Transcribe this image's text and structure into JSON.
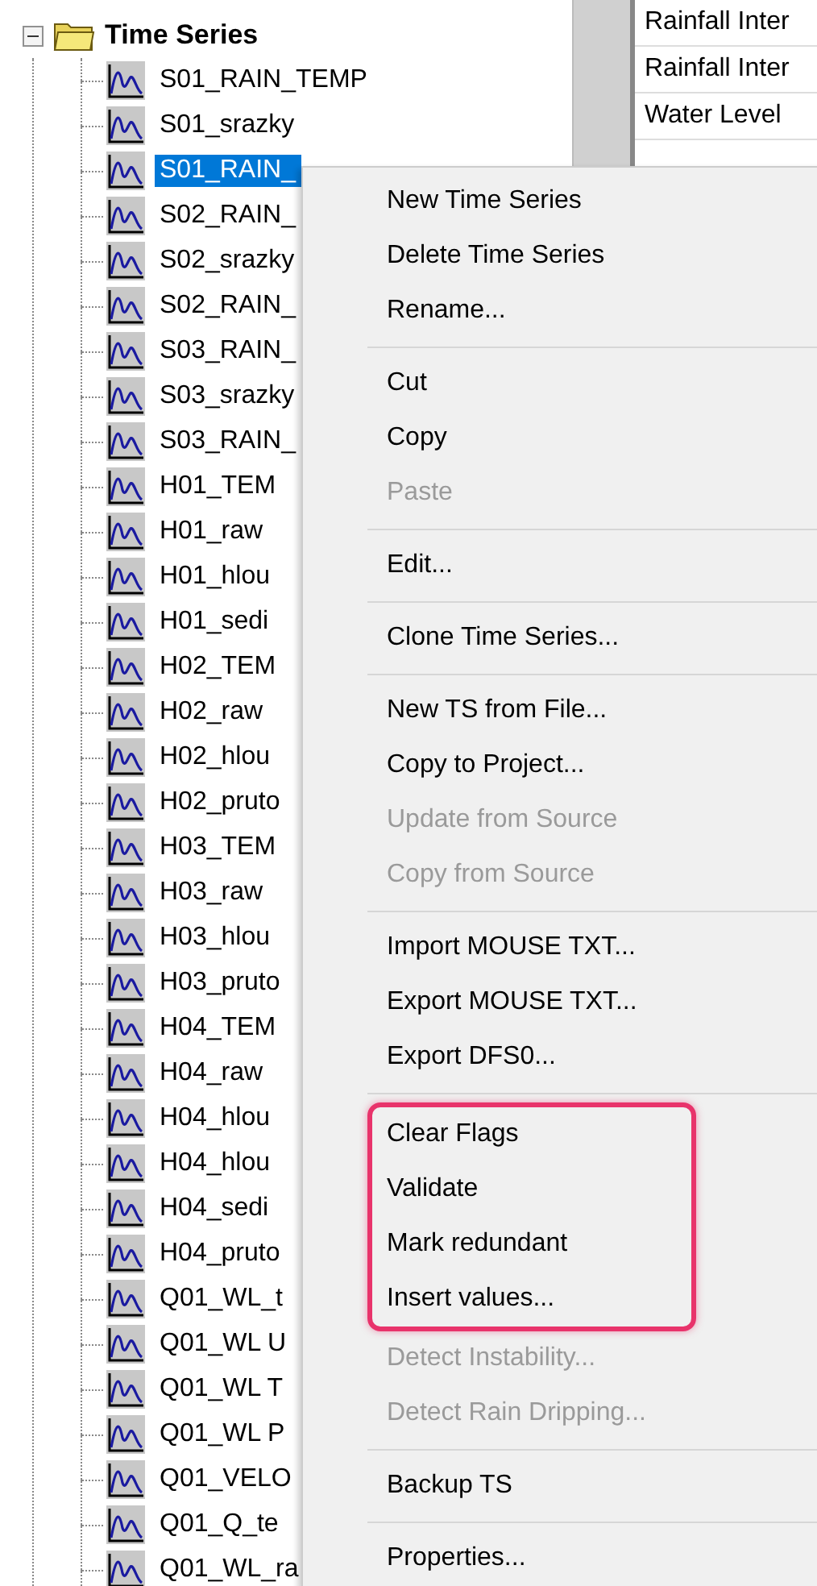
{
  "tree": {
    "root": {
      "label": "Time Series",
      "expanded": true
    },
    "items": [
      {
        "label": "S01_RAIN_TEMP",
        "selected": false
      },
      {
        "label": "S01_srazky",
        "selected": false
      },
      {
        "label": "S01_RAIN_",
        "selected": true
      },
      {
        "label": "S02_RAIN_",
        "selected": false
      },
      {
        "label": "S02_srazky",
        "selected": false
      },
      {
        "label": "S02_RAIN_",
        "selected": false
      },
      {
        "label": "S03_RAIN_",
        "selected": false
      },
      {
        "label": "S03_srazky",
        "selected": false
      },
      {
        "label": "S03_RAIN_",
        "selected": false
      },
      {
        "label": "H01_TEM",
        "selected": false
      },
      {
        "label": "H01_raw",
        "selected": false
      },
      {
        "label": "H01_hlou",
        "selected": false
      },
      {
        "label": "H01_sedi",
        "selected": false
      },
      {
        "label": "H02_TEM",
        "selected": false
      },
      {
        "label": "H02_raw",
        "selected": false
      },
      {
        "label": "H02_hlou",
        "selected": false
      },
      {
        "label": "H02_pruto",
        "selected": false
      },
      {
        "label": "H03_TEM",
        "selected": false
      },
      {
        "label": "H03_raw",
        "selected": false
      },
      {
        "label": "H03_hlou",
        "selected": false
      },
      {
        "label": "H03_pruto",
        "selected": false
      },
      {
        "label": "H04_TEM",
        "selected": false
      },
      {
        "label": "H04_raw",
        "selected": false
      },
      {
        "label": "H04_hlou",
        "selected": false
      },
      {
        "label": "H04_hlou",
        "selected": false
      },
      {
        "label": "H04_sedi",
        "selected": false
      },
      {
        "label": "H04_pruto",
        "selected": false
      },
      {
        "label": "Q01_WL_t",
        "selected": false
      },
      {
        "label": "Q01_WL U",
        "selected": false
      },
      {
        "label": "Q01_WL T",
        "selected": false
      },
      {
        "label": "Q01_WL P",
        "selected": false
      },
      {
        "label": "Q01_VELO",
        "selected": false
      },
      {
        "label": "Q01_Q_te",
        "selected": false
      },
      {
        "label": "Q01_WL_ra",
        "selected": false
      }
    ]
  },
  "list": {
    "rows": [
      "Rainfall Inter",
      "Rainfall Inter",
      "Water Level"
    ]
  },
  "context_menu": {
    "items": [
      {
        "kind": "item",
        "label": "New Time Series",
        "disabled": false,
        "highlighted": false
      },
      {
        "kind": "item",
        "label": "Delete Time Series",
        "disabled": false,
        "highlighted": false
      },
      {
        "kind": "item",
        "label": "Rename...",
        "disabled": false,
        "highlighted": false
      },
      {
        "kind": "separator"
      },
      {
        "kind": "item",
        "label": "Cut",
        "disabled": false,
        "highlighted": false
      },
      {
        "kind": "item",
        "label": "Copy",
        "disabled": false,
        "highlighted": false
      },
      {
        "kind": "item",
        "label": "Paste",
        "disabled": true,
        "highlighted": false
      },
      {
        "kind": "separator"
      },
      {
        "kind": "item",
        "label": "Edit...",
        "disabled": false,
        "highlighted": false
      },
      {
        "kind": "separator"
      },
      {
        "kind": "item",
        "label": "Clone Time Series...",
        "disabled": false,
        "highlighted": false
      },
      {
        "kind": "separator"
      },
      {
        "kind": "item",
        "label": "New TS from File...",
        "disabled": false,
        "highlighted": false
      },
      {
        "kind": "item",
        "label": "Copy to Project...",
        "disabled": false,
        "highlighted": false
      },
      {
        "kind": "item",
        "label": "Update from Source",
        "disabled": true,
        "highlighted": false
      },
      {
        "kind": "item",
        "label": "Copy from Source",
        "disabled": true,
        "highlighted": false
      },
      {
        "kind": "separator"
      },
      {
        "kind": "item",
        "label": "Import MOUSE TXT...",
        "disabled": false,
        "highlighted": false
      },
      {
        "kind": "item",
        "label": "Export MOUSE TXT...",
        "disabled": false,
        "highlighted": false
      },
      {
        "kind": "item",
        "label": "Export DFS0...",
        "disabled": false,
        "highlighted": false
      },
      {
        "kind": "separator"
      },
      {
        "kind": "item",
        "label": "Clear Flags",
        "disabled": false,
        "highlighted": true
      },
      {
        "kind": "item",
        "label": "Validate",
        "disabled": false,
        "highlighted": true
      },
      {
        "kind": "item",
        "label": "Mark redundant",
        "disabled": false,
        "highlighted": true
      },
      {
        "kind": "item",
        "label": "Insert values...",
        "disabled": false,
        "highlighted": true
      },
      {
        "kind": "item",
        "label": "Detect Instability...",
        "disabled": true,
        "highlighted": false
      },
      {
        "kind": "item",
        "label": "Detect Rain Dripping...",
        "disabled": true,
        "highlighted": false
      },
      {
        "kind": "separator"
      },
      {
        "kind": "item",
        "label": "Backup TS",
        "disabled": false,
        "highlighted": false
      },
      {
        "kind": "separator"
      },
      {
        "kind": "item",
        "label": "Properties...",
        "disabled": false,
        "highlighted": false
      }
    ]
  }
}
